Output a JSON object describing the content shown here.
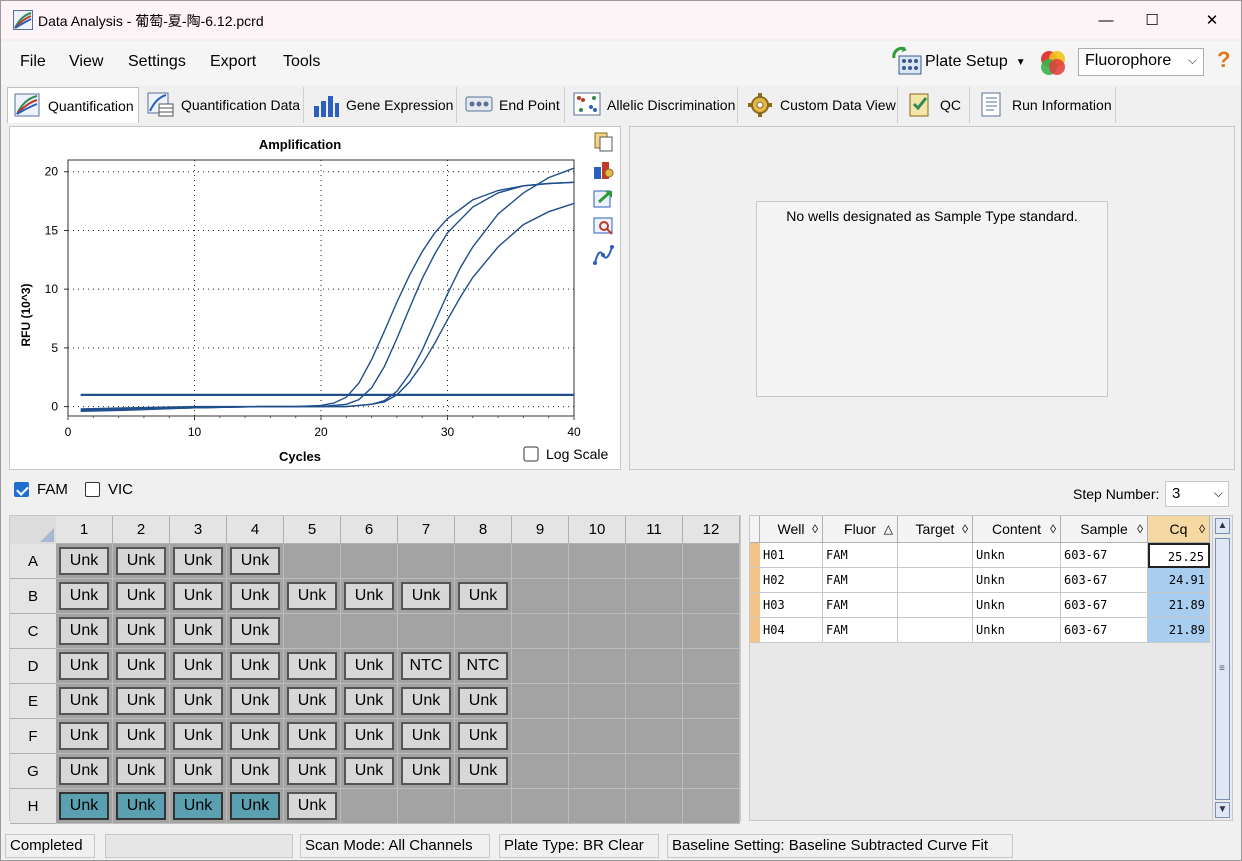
{
  "window": {
    "title": "Data Analysis - 葡萄-夏-陶-6.12.pcrd",
    "minimize": "—",
    "maximize": "☐",
    "close": "✕"
  },
  "menu": {
    "file": "File",
    "view": "View",
    "settings": "Settings",
    "export": "Export",
    "tools": "Tools",
    "plate_setup": "Plate Setup",
    "fluorophore_value": "Fluorophore",
    "help": "?"
  },
  "tabs": [
    {
      "label": "Quantification",
      "active": true
    },
    {
      "label": "Quantification Data"
    },
    {
      "label": "Gene Expression"
    },
    {
      "label": "End Point"
    },
    {
      "label": "Allelic Discrimination"
    },
    {
      "label": "Custom Data View"
    },
    {
      "label": "QC"
    },
    {
      "label": "Run Information"
    }
  ],
  "chart_data": {
    "type": "line",
    "title": "Amplification",
    "xlabel": "Cycles",
    "ylabel": "RFU (10^3)",
    "xlim": [
      0,
      40
    ],
    "ylim": [
      -0.8,
      21
    ],
    "xticks": [
      0,
      10,
      20,
      30,
      40
    ],
    "yticks": [
      0,
      5,
      10,
      15,
      20
    ],
    "grid": true,
    "log_scale_label": "Log Scale",
    "log_scale": false,
    "threshold": 1.0,
    "line_color": "#1f4e8c",
    "series": [
      {
        "x": [
          1,
          5,
          10,
          15,
          18,
          20,
          21,
          22,
          23,
          24,
          25,
          26,
          27,
          28,
          29,
          30,
          32,
          34,
          36,
          38,
          40
        ],
        "values": [
          -0.3,
          -0.2,
          -0.1,
          0.0,
          0.0,
          0.1,
          0.3,
          0.8,
          2.0,
          4.0,
          6.4,
          8.9,
          11.2,
          13.2,
          14.8,
          16.0,
          17.6,
          18.4,
          18.8,
          19.0,
          19.1
        ]
      },
      {
        "x": [
          1,
          5,
          10,
          15,
          18,
          20,
          22,
          23,
          24,
          25,
          26,
          27,
          28,
          29,
          30,
          32,
          34,
          36,
          38,
          40
        ],
        "values": [
          -0.4,
          -0.3,
          -0.1,
          0.0,
          0.0,
          0.0,
          0.2,
          0.6,
          1.6,
          3.4,
          5.8,
          8.4,
          10.9,
          13.0,
          14.8,
          17.0,
          18.2,
          18.8,
          19.0,
          19.1
        ]
      },
      {
        "x": [
          1,
          5,
          10,
          15,
          20,
          22,
          24,
          25,
          26,
          27,
          28,
          29,
          30,
          31,
          32,
          34,
          36,
          38,
          40
        ],
        "values": [
          -0.3,
          -0.2,
          -0.1,
          0.0,
          0.0,
          0.0,
          0.2,
          0.5,
          1.3,
          2.8,
          4.8,
          7.2,
          9.6,
          11.8,
          13.6,
          16.4,
          18.2,
          19.5,
          20.3
        ]
      },
      {
        "x": [
          1,
          5,
          10,
          15,
          20,
          22,
          24,
          25,
          26,
          27,
          28,
          29,
          30,
          31,
          32,
          34,
          36,
          38,
          40
        ],
        "values": [
          -0.2,
          -0.1,
          0.0,
          0.0,
          0.0,
          0.0,
          0.2,
          0.4,
          1.0,
          2.1,
          3.6,
          5.4,
          7.4,
          9.3,
          11.0,
          13.6,
          15.5,
          16.6,
          17.3
        ]
      }
    ]
  },
  "standard_panel": {
    "message": "No wells designated as Sample Type standard."
  },
  "filters": {
    "fam_label": "FAM",
    "fam_checked": true,
    "vic_label": "VIC",
    "vic_checked": false,
    "step_label": "Step Number:",
    "step_value": "3"
  },
  "plate": {
    "columns": [
      "1",
      "2",
      "3",
      "4",
      "5",
      "6",
      "7",
      "8",
      "9",
      "10",
      "11",
      "12"
    ],
    "rows": [
      {
        "label": "A",
        "cells": [
          "Unk",
          "Unk",
          "Unk",
          "Unk",
          "",
          "",
          "",
          "",
          "",
          "",
          "",
          ""
        ]
      },
      {
        "label": "B",
        "cells": [
          "Unk",
          "Unk",
          "Unk",
          "Unk",
          "Unk",
          "Unk",
          "Unk",
          "Unk",
          "",
          "",
          "",
          ""
        ]
      },
      {
        "label": "C",
        "cells": [
          "Unk",
          "Unk",
          "Unk",
          "Unk",
          "",
          "",
          "",
          "",
          "",
          "",
          "",
          ""
        ]
      },
      {
        "label": "D",
        "cells": [
          "Unk",
          "Unk",
          "Unk",
          "Unk",
          "Unk",
          "Unk",
          "NTC",
          "NTC",
          "",
          "",
          "",
          ""
        ]
      },
      {
        "label": "E",
        "cells": [
          "Unk",
          "Unk",
          "Unk",
          "Unk",
          "Unk",
          "Unk",
          "Unk",
          "Unk",
          "",
          "",
          "",
          ""
        ]
      },
      {
        "label": "F",
        "cells": [
          "Unk",
          "Unk",
          "Unk",
          "Unk",
          "Unk",
          "Unk",
          "Unk",
          "Unk",
          "",
          "",
          "",
          ""
        ]
      },
      {
        "label": "G",
        "cells": [
          "Unk",
          "Unk",
          "Unk",
          "Unk",
          "Unk",
          "Unk",
          "Unk",
          "Unk",
          "",
          "",
          "",
          ""
        ]
      },
      {
        "label": "H",
        "cells": [
          "Unk",
          "Unk",
          "Unk",
          "Unk",
          "Unk",
          "",
          "",
          "",
          "",
          "",
          "",
          ""
        ],
        "selected": [
          0,
          1,
          2,
          3
        ]
      }
    ]
  },
  "results_table": {
    "headers": [
      "Well",
      "Fluor",
      "Target",
      "Content",
      "Sample",
      "Cq"
    ],
    "rows": [
      [
        "H01",
        "FAM",
        "",
        "Unkn",
        "603-67",
        "25.25"
      ],
      [
        "H02",
        "FAM",
        "",
        "Unkn",
        "603-67",
        "24.91"
      ],
      [
        "H03",
        "FAM",
        "",
        "Unkn",
        "603-67",
        "21.89"
      ],
      [
        "H04",
        "FAM",
        "",
        "Unkn",
        "603-67",
        "21.89"
      ]
    ]
  },
  "status": {
    "state": "Completed",
    "scan_mode": "Scan Mode: All Channels",
    "plate_type": "Plate Type: BR Clear",
    "baseline": "Baseline Setting: Baseline Subtracted Curve Fit"
  }
}
